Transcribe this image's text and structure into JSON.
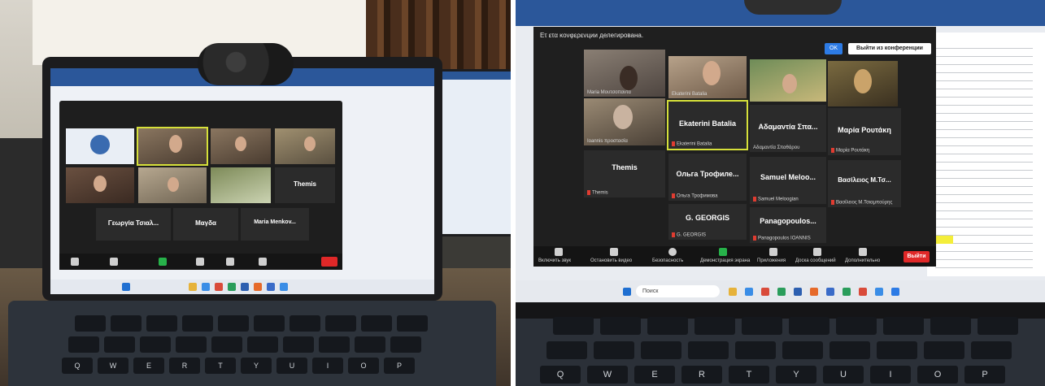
{
  "left_meeting": {
    "tiles": [
      {
        "name": "",
        "sub": ""
      },
      {
        "name": "",
        "sub": ""
      },
      {
        "name": "",
        "sub": ""
      },
      {
        "name": "",
        "sub": ""
      },
      {
        "name": "",
        "sub": ""
      },
      {
        "name": "",
        "sub": ""
      },
      {
        "name": "",
        "sub": ""
      },
      {
        "name": "Themis",
        "sub": ""
      },
      {
        "name": "Γεωργία Τσιαλ...",
        "sub": ""
      },
      {
        "name": "Μαγδα",
        "sub": ""
      },
      {
        "name": "Maria Menkov...",
        "sub": ""
      }
    ],
    "leave": ""
  },
  "right_meeting": {
    "header": "Eτ ετα κονφερενции делегирована.",
    "ok": "OK",
    "leave_conf": "Выйти из конференции",
    "tiles": [
      {
        "name": "",
        "sub": "Maria Μουτσοπαντα"
      },
      {
        "name": "",
        "sub": "Ekaterini Batalia"
      },
      {
        "name": "",
        "sub": ""
      },
      {
        "name": "",
        "sub": ""
      },
      {
        "name": "",
        "sub": "Ioannis προστασία"
      },
      {
        "name": "Ekaterini Batalia",
        "sub": "Ekaterini Batalia"
      },
      {
        "name": "Αδαμαντία Σπα...",
        "sub": "Αδαμαντία Σπαθάρου"
      },
      {
        "name": "Μαρία Ρουτάκη",
        "sub": "Μαρία Ρουτάκη"
      },
      {
        "name": "Themis",
        "sub": "Themis"
      },
      {
        "name": "Ольга Трофиле...",
        "sub": "Ольга Трофимова"
      },
      {
        "name": "Samuel Meloo...",
        "sub": "Samuel Meloogian"
      },
      {
        "name": "Βασίλειος Μ.Τσ...",
        "sub": "Βασίλειος Μ.Τσιαμπούρης"
      },
      {
        "name": "G. GEORGIS",
        "sub": "G. GEORGIS"
      },
      {
        "name": "Panagopoulos...",
        "sub": "Panagopoulos IOANNIS"
      }
    ],
    "toolbar": [
      "Включить звук",
      "Остановить видео",
      "Безопасность",
      "Демонстрация экрана",
      "Приложения",
      "Доска сообщений",
      "Дополнительно"
    ],
    "leave": "Выйти",
    "taskbar_search": "Поиск"
  },
  "keyboard_right": [
    "Q",
    "W",
    "E",
    "R",
    "T",
    "Y",
    "U",
    "I",
    "O",
    "P"
  ],
  "keyboard_left": [
    "Q",
    "W",
    "E",
    "R",
    "T",
    "Y",
    "U",
    "I",
    "O",
    "P"
  ]
}
